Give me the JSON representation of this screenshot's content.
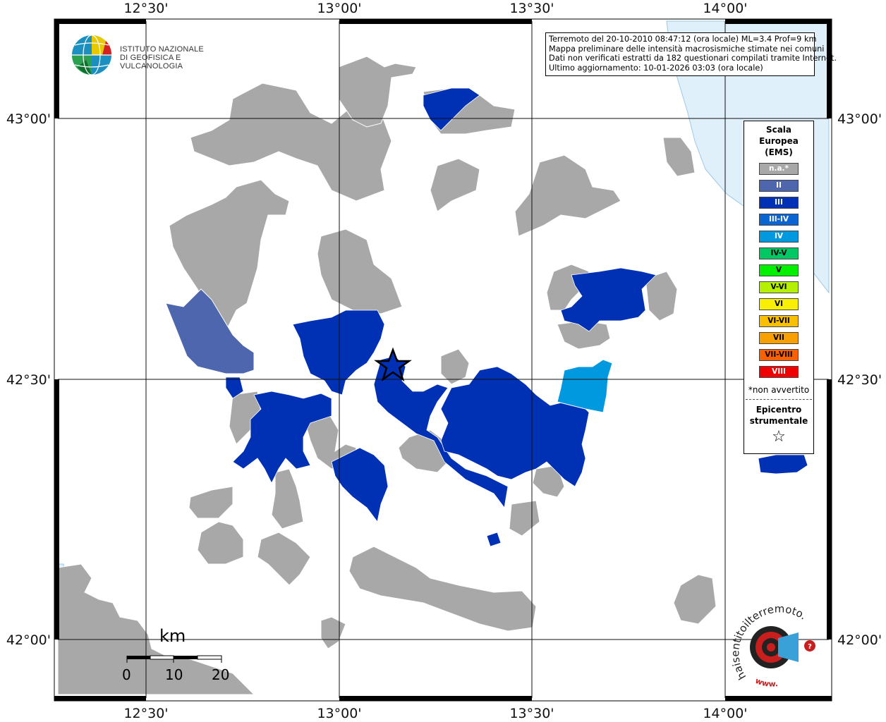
{
  "map": {
    "lon_labels": [
      "12°30'",
      "13°00'",
      "13°30'",
      "14°00'"
    ],
    "lat_labels": [
      "43°00'",
      "42°30'",
      "42°00'"
    ],
    "colors": {
      "sea": "#e0f0fb",
      "na": "#a8a8a8",
      "ems_II": "#4d66ad",
      "ems_III": "#0030b4",
      "ems_IV": "#0099e0",
      "frame": "#000000"
    }
  },
  "info": {
    "line1": "Terremoto del 20-10-2010 08:47:12 (ora locale) ML=3.4 Prof=9 km",
    "line2": "Mappa preliminare delle intensità macrosismiche stimate nei comuni",
    "line3": "Dati non verificati estratti da 182 questionari compilati tramite Internet.",
    "line4": "Ultimo aggiornamento: 10-01-2026 03:03 (ora locale)"
  },
  "legend": {
    "title_lines": [
      "Scala",
      "Europea",
      "(EMS)"
    ],
    "items": [
      {
        "label": "n.a.*",
        "color": "#a8a8a8",
        "text_color": "#ffffff"
      },
      {
        "label": "II",
        "color": "#4d66ad",
        "text_color": "#ffffff"
      },
      {
        "label": "III",
        "color": "#0030b4",
        "text_color": "#ffffff"
      },
      {
        "label": "III-IV",
        "color": "#0a64d2",
        "text_color": "#ffffff"
      },
      {
        "label": "IV",
        "color": "#0099e0",
        "text_color": "#ffffff"
      },
      {
        "label": "IV-V",
        "color": "#00c864",
        "text_color": "#000000"
      },
      {
        "label": "V",
        "color": "#00f000",
        "text_color": "#000000"
      },
      {
        "label": "V-VI",
        "color": "#b4f000",
        "text_color": "#000000"
      },
      {
        "label": "VI",
        "color": "#f8f000",
        "text_color": "#000000"
      },
      {
        "label": "VI-VII",
        "color": "#f8c000",
        "text_color": "#000000"
      },
      {
        "label": "VII",
        "color": "#f8a000",
        "text_color": "#000000"
      },
      {
        "label": "VII-VIII",
        "color": "#f86000",
        "text_color": "#000000"
      },
      {
        "label": "VIII",
        "color": "#f00000",
        "text_color": "#ffffff"
      }
    ],
    "note": "*non avvertito",
    "epicenter_lines": [
      "Epicentro",
      "strumentale"
    ],
    "star_glyph": "☆"
  },
  "ingv_logo": {
    "line1": "ISTITUTO NAZIONALE",
    "line2": "DI GEOFISICA E VULCANOLOGIA"
  },
  "scale_bar": {
    "unit": "km",
    "ticks": [
      "0",
      "10",
      "20"
    ]
  },
  "hst_logo": {
    "text": "haisentitoilterremoto.it",
    "url": "www."
  }
}
